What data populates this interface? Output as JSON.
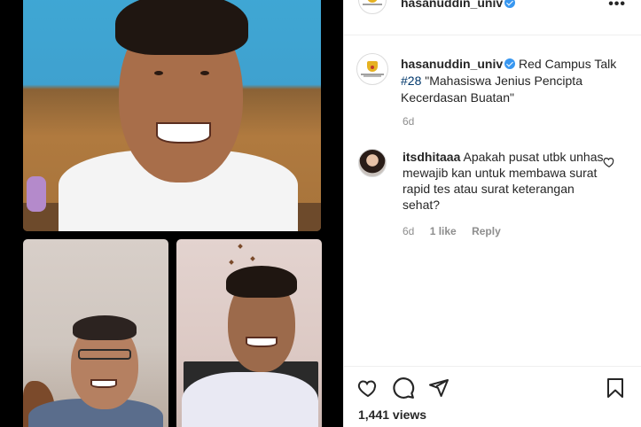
{
  "post": {
    "author": "hasanuddin_univ",
    "caption_prefix": "Red Campus Talk",
    "caption_tag": "#28",
    "caption_body": "\"Mahasiswa Jenius Pencipta Kecerdasan Buatan\"",
    "age": "6d"
  },
  "comment": {
    "author": "itsdhitaaa",
    "text": "Apakah pusat utbk unhas mewajib kan untuk membawa surat rapid tes atau surat keterangan sehat?",
    "age": "6d",
    "likes": "1 like",
    "reply_label": "Reply"
  },
  "actions": {
    "views": "1,441 views"
  },
  "icons": {
    "more": "more-options-icon",
    "like": "heart-icon",
    "comment": "comment-bubble-icon",
    "share": "paper-plane-icon",
    "save": "bookmark-icon",
    "verified": "verified-badge-icon"
  },
  "colors": {
    "accent_link": "#00376b",
    "verified": "#3897f0",
    "muted": "#8e8e8e",
    "text": "#262626"
  }
}
